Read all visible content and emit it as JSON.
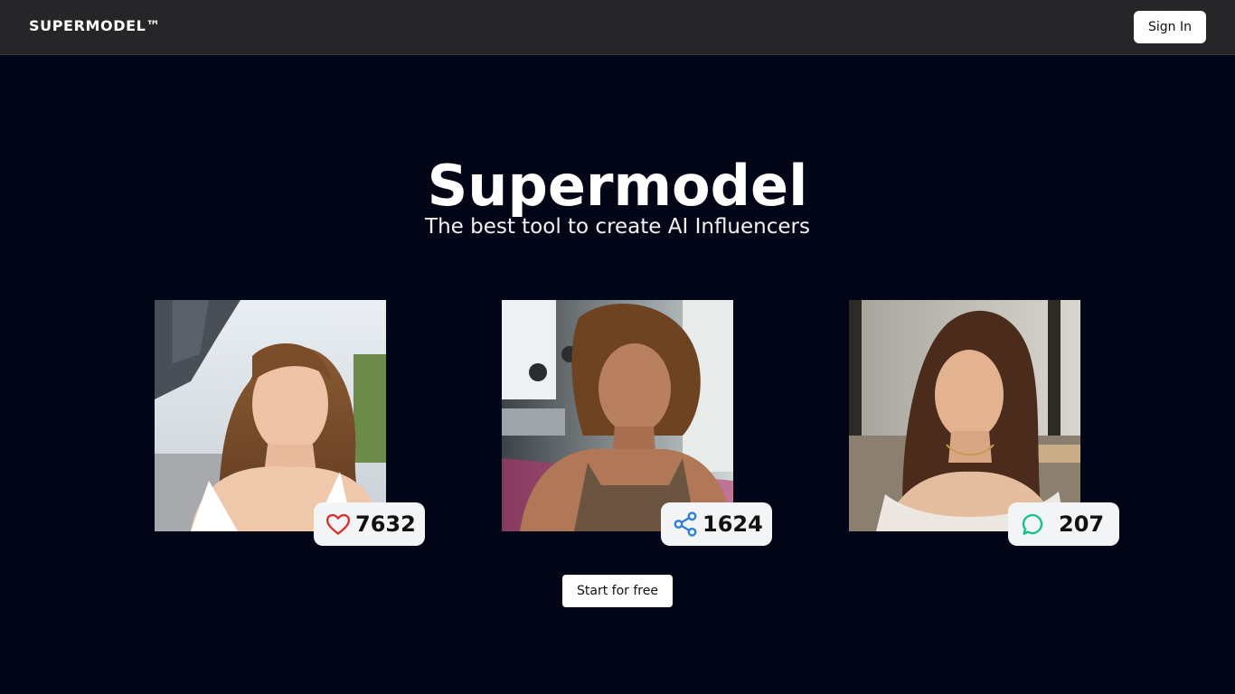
{
  "header": {
    "brand": "SUPERMODEL™",
    "signin_label": "Sign In"
  },
  "hero": {
    "title": "Supermodel",
    "subtitle": "The best tool to create AI Influencers"
  },
  "cards": [
    {
      "photo": "woman-at-eiffel-tower",
      "stat_icon": "heart-icon",
      "stat_value": "7632",
      "icon_color": "#d93030"
    },
    {
      "photo": "woman-at-gym",
      "stat_icon": "share-icon",
      "stat_value": "1624",
      "icon_color": "#2f7fd6"
    },
    {
      "photo": "woman-at-cafe",
      "stat_icon": "chat-icon",
      "stat_value": "207",
      "icon_color": "#17c08c"
    }
  ],
  "cta": {
    "label": "Start for free"
  },
  "colors": {
    "background": "#030617",
    "navbar": "#262629",
    "badge": "#f3f4f6"
  }
}
